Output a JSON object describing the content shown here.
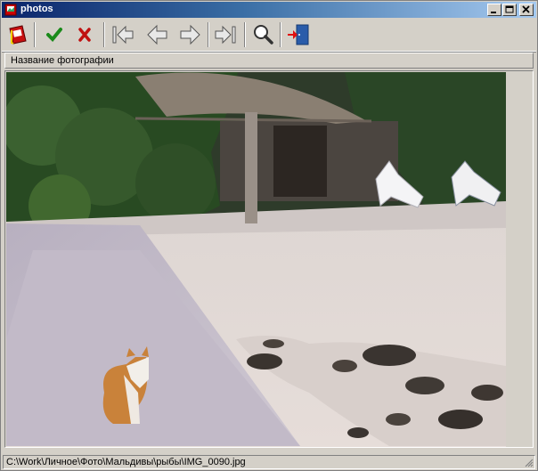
{
  "window": {
    "title": "photos"
  },
  "title_buttons": [
    {
      "name": "minimize-button",
      "icon": "minimize-icon"
    },
    {
      "name": "maximize-button",
      "icon": "maximize-icon"
    },
    {
      "name": "close-button",
      "icon": "close-icon"
    }
  ],
  "toolbar": {
    "tools": [
      {
        "name": "album-button",
        "icon": "photo-album-icon"
      },
      {
        "name": "accept-button",
        "icon": "check-icon"
      },
      {
        "name": "reject-button",
        "icon": "x-icon"
      },
      {
        "name": "first-photo-button",
        "icon": "first-arrow-icon"
      },
      {
        "name": "previous-photo-button",
        "icon": "left-arrow-icon"
      },
      {
        "name": "next-photo-button",
        "icon": "right-arrow-icon"
      },
      {
        "name": "last-photo-button",
        "icon": "last-arrow-icon"
      },
      {
        "name": "zoom-button",
        "icon": "magnifier-icon"
      },
      {
        "name": "exit-button",
        "icon": "exit-door-icon"
      }
    ]
  },
  "caption": {
    "text": "Название фотографии"
  },
  "photo": {
    "description_icon": "beach-cat-photo"
  },
  "status": {
    "path": "C:\\Work\\Личное\\Фото\\Мальдивы\\рыбы\\IMG_0090.jpg"
  },
  "colors": {
    "title_active": "#0a246a",
    "title_fade": "#a6caf0",
    "face": "#d4d0c8"
  }
}
